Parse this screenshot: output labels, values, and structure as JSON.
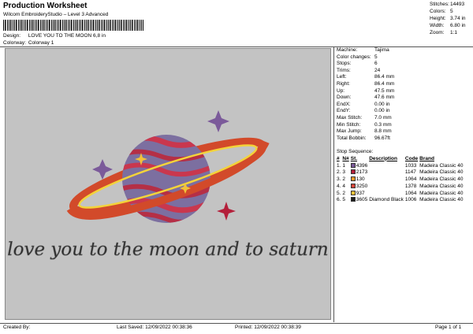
{
  "header": {
    "title": "Production Worksheet",
    "subtitle": "Wilcom EmbroideryStudio – Level 3 Advanced",
    "design_label": "Design:",
    "design_value": "LOVE YOU TO THE MOON 6,8 in",
    "colorway_label": "Colorway:",
    "colorway_value": "Colorway 1"
  },
  "summary": [
    {
      "k": "Stitches:",
      "v": "14493"
    },
    {
      "k": "Colors:",
      "v": "5"
    },
    {
      "k": "Height:",
      "v": "3.74 in"
    },
    {
      "k": "Width:",
      "v": "6.80 in"
    },
    {
      "k": "Zoom:",
      "v": "1:1"
    }
  ],
  "params": [
    {
      "k": "Machine:",
      "v": "Tajima"
    },
    {
      "k": "Color changes:",
      "v": "5"
    },
    {
      "k": "Stops:",
      "v": "6"
    },
    {
      "k": "Trims:",
      "v": "24"
    },
    {
      "k": "Left:",
      "v": "86.4 mm"
    },
    {
      "k": "Right:",
      "v": "86.4 mm"
    },
    {
      "k": "Up:",
      "v": "47.5 mm"
    },
    {
      "k": "Down:",
      "v": "47.6 mm"
    },
    {
      "k": "EndX:",
      "v": "0.00 in"
    },
    {
      "k": "EndY:",
      "v": "0.00 in"
    },
    {
      "k": "Max Stitch:",
      "v": "7.0 mm"
    },
    {
      "k": "Min Stitch:",
      "v": "0.3 mm"
    },
    {
      "k": "Max Jump:",
      "v": "8.8 mm"
    },
    {
      "k": "Total Bobbin:",
      "v": "96.67ft"
    }
  ],
  "sequence": {
    "heading": "Stop Sequence:",
    "headers": {
      "n": "#",
      "n_abbr": "N#",
      "st": "St.",
      "description": "Description",
      "code": "Code",
      "brand": "Brand"
    },
    "rows": [
      {
        "n": "1.",
        "num": "1",
        "color": "#7b5a9a",
        "st": "4396",
        "desc": "",
        "code": "1033",
        "brand": "Madeira Classic 40"
      },
      {
        "n": "2.",
        "num": "3",
        "color": "#b41f3a",
        "st": "2173",
        "desc": "",
        "code": "1147",
        "brand": "Madeira Classic 40"
      },
      {
        "n": "3.",
        "num": "2",
        "color": "#e89a2a",
        "st": "130",
        "desc": "",
        "code": "1064",
        "brand": "Madeira Classic 40"
      },
      {
        "n": "4.",
        "num": "4",
        "color": "#d7463a",
        "st": "3250",
        "desc": "",
        "code": "1378",
        "brand": "Madeira Classic 40"
      },
      {
        "n": "5.",
        "num": "2",
        "color": "#f2c23a",
        "st": "937",
        "desc": "",
        "code": "1064",
        "brand": "Madeira Classic 40"
      },
      {
        "n": "6.",
        "num": "5",
        "color": "#1e1e1e",
        "st": "3605",
        "desc": "Diamond Black",
        "code": "1006",
        "brand": "Madeira Classic 40"
      }
    ]
  },
  "design": {
    "text": "love you to the moon and to saturn"
  },
  "footer": {
    "created_by": "Created By:",
    "last_saved": "Last Saved: 12/09/2022 00:38:36",
    "printed": "Printed: 12/09/2022 00:38:39",
    "page": "Page 1 of 1"
  }
}
